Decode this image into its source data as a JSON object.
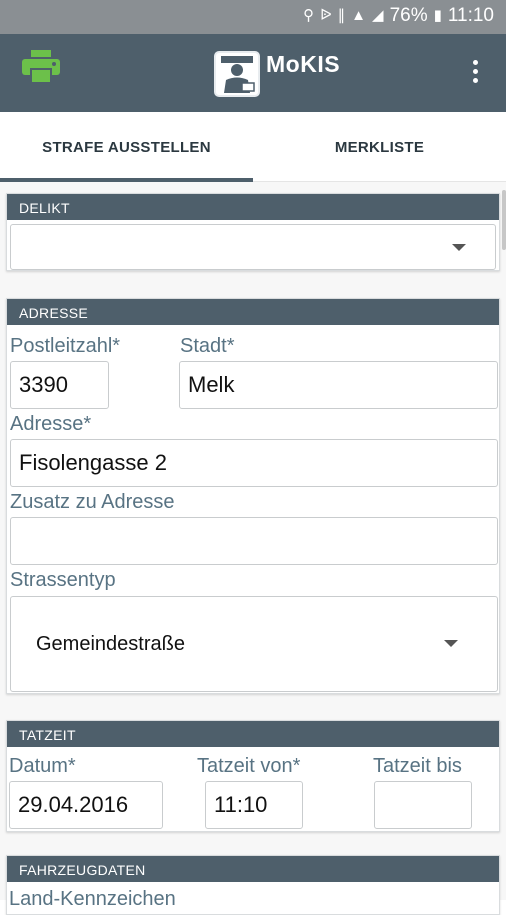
{
  "status_bar": {
    "icons": [
      "location-icon",
      "bluetooth-icon",
      "vibrate-icon",
      "wifi-icon",
      "signal-icon",
      "battery-icon"
    ],
    "battery": "76%",
    "time": "11:10"
  },
  "app_bar": {
    "title": "MoKIS",
    "logo_text": "MoKIS",
    "accent_color": "#4e5f6b",
    "print_icon_color": "#6cc04a"
  },
  "tabs": [
    {
      "label": "STRAFE AUSSTELLEN",
      "active": true
    },
    {
      "label": "MERKLISTE",
      "active": false
    }
  ],
  "delikt": {
    "header": "DELIKT",
    "value": ""
  },
  "adresse": {
    "header": "ADRESSE",
    "postleitzahl_label": "Postleitzahl*",
    "postleitzahl_value": "3390",
    "stadt_label": "Stadt*",
    "stadt_value": "Melk",
    "adresse_label": "Adresse*",
    "adresse_value": "Fisolengasse 2",
    "zusatz_label": "Zusatz zu Adresse",
    "zusatz_value": "",
    "strassentyp_label": "Strassentyp",
    "strassentyp_value": "Gemeindestraße"
  },
  "tatzeit": {
    "header": "TATZEIT",
    "datum_label": "Datum*",
    "datum_value": "29.04.2016",
    "von_label": "Tatzeit von*",
    "von_value": "11:10",
    "bis_label": "Tatzeit bis",
    "bis_value": ""
  },
  "fahrzeugdaten": {
    "header": "FAHRZEUGDATEN",
    "land_label": "Land-Kennzeichen"
  }
}
